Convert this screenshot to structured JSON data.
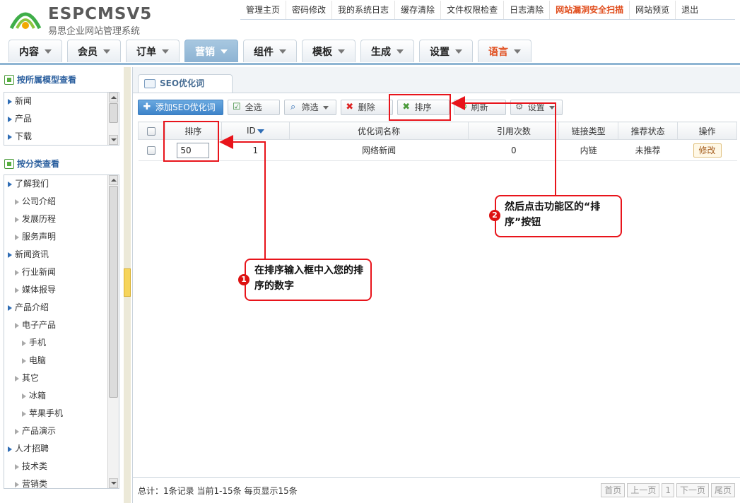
{
  "logo": {
    "brand": "ESPCMSV5",
    "subtitle": "易思企业网站管理系统"
  },
  "topnav": [
    "管理主页",
    "密码修改",
    "我的系统日志",
    "缓存清除",
    "文件权限检查",
    "日志清除",
    "网站漏洞安全扫描",
    "网站预览",
    "退出"
  ],
  "mainnav": [
    "内容",
    "会员",
    "订单",
    "营销",
    "组件",
    "模板",
    "生成",
    "设置",
    "语言"
  ],
  "sidebar": {
    "model_title": "按所属模型查看",
    "model_items": [
      "新闻",
      "产品",
      "下载"
    ],
    "category_title": "按分类查看",
    "categories": [
      "了解我们",
      "公司介绍",
      "发展历程",
      "服务声明",
      "新闻资讯",
      "行业新闻",
      "媒体报导",
      "产品介绍",
      "电子产品",
      "手机",
      "电脑",
      "其它",
      "冰箱",
      "苹果手机",
      "产品演示",
      "人才招聘",
      "技术类",
      "营销类"
    ]
  },
  "content_tab": "SEO优化词",
  "toolbar": {
    "add": "添加SEO优化词",
    "select_all": "全选",
    "filter": "筛选",
    "delete": "删除",
    "sort": "排序",
    "refresh": "刷新",
    "settings": "设置"
  },
  "table": {
    "headers": [
      "排序",
      "ID",
      "优化词名称",
      "引用次数",
      "链接类型",
      "推荐状态",
      "操作"
    ],
    "rows": [
      {
        "sort": "50",
        "id": "1",
        "name": "网络新闻",
        "refs": "0",
        "link_type": "内链",
        "recommend": "未推荐",
        "action": "修改"
      }
    ]
  },
  "footer": {
    "summary": "总计：1条记录 当前1-15条 每页显示15条",
    "pager": [
      "首页",
      "上一页",
      "1",
      "下一页",
      "尾页"
    ]
  },
  "annotations": {
    "step1_num": "1",
    "step1": "在排序输入框中入您的排序的数字",
    "step2_num": "2",
    "step2": "然后点击功能区的“排序”按钮"
  },
  "colors": {
    "accent": "#8db3d3",
    "highlight": "#e8141b",
    "hot": "#e04c1b"
  }
}
